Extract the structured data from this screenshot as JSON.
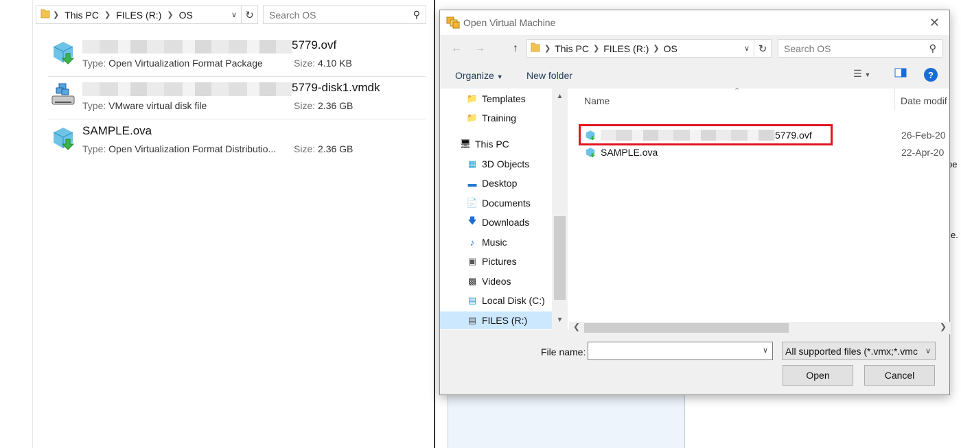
{
  "explorer": {
    "breadcrumb": [
      "This PC",
      "FILES (R:)",
      "OS"
    ],
    "search_placeholder": "Search OS",
    "files": [
      {
        "name_tail": "5779.ovf",
        "type_label": "Type:",
        "type": "Open Virtualization Format Package",
        "size_label": "Size:",
        "size": "4.10 KB",
        "icon": "ovf-package-icon"
      },
      {
        "name_tail": "5779-disk1.vmdk",
        "type_label": "Type:",
        "type": "VMware virtual disk file",
        "size_label": "Size:",
        "size": "2.36 GB",
        "icon": "vmdk-disk-icon"
      },
      {
        "name": "SAMPLE.ova",
        "type_label": "Type:",
        "type": "Open Virtualization Format Distributio...",
        "size_label": "Size:",
        "size": "2.36 GB",
        "icon": "ovf-package-icon"
      }
    ]
  },
  "background": {
    "peek_1": "be",
    "peek_2": "e."
  },
  "dialog": {
    "title": "Open Virtual Machine",
    "breadcrumb": [
      "This PC",
      "FILES (R:)",
      "OS"
    ],
    "search_placeholder": "Search OS",
    "toolbar": {
      "organize": "Organize",
      "new_folder": "New folder"
    },
    "nav": [
      {
        "label": "Templates",
        "icon": "folder-icon"
      },
      {
        "label": "Training",
        "icon": "folder-icon"
      },
      {
        "label": "This PC",
        "icon": "computer-icon"
      },
      {
        "label": "3D Objects",
        "icon": "3d-objects-icon"
      },
      {
        "label": "Desktop",
        "icon": "desktop-icon"
      },
      {
        "label": "Documents",
        "icon": "documents-icon"
      },
      {
        "label": "Downloads",
        "icon": "downloads-icon"
      },
      {
        "label": "Music",
        "icon": "music-icon"
      },
      {
        "label": "Pictures",
        "icon": "pictures-icon"
      },
      {
        "label": "Videos",
        "icon": "videos-icon"
      },
      {
        "label": "Local Disk (C:)",
        "icon": "local-disk-icon"
      },
      {
        "label": "FILES (R:)",
        "icon": "network-drive-icon"
      }
    ],
    "columns": {
      "name": "Name",
      "date": "Date modif"
    },
    "files": [
      {
        "name_tail": "5779.ovf",
        "date": "26-Feb-20"
      },
      {
        "name": "SAMPLE.ova",
        "date": "22-Apr-20"
      }
    ],
    "footer": {
      "file_name_label": "File name:",
      "file_name_value": "",
      "filter": "All supported files (*.vmx;*.vmc",
      "open": "Open",
      "cancel": "Cancel"
    },
    "colors": {
      "highlight": "#e0141c",
      "selection": "#cce8ff",
      "help": "#1a6cd6"
    }
  }
}
